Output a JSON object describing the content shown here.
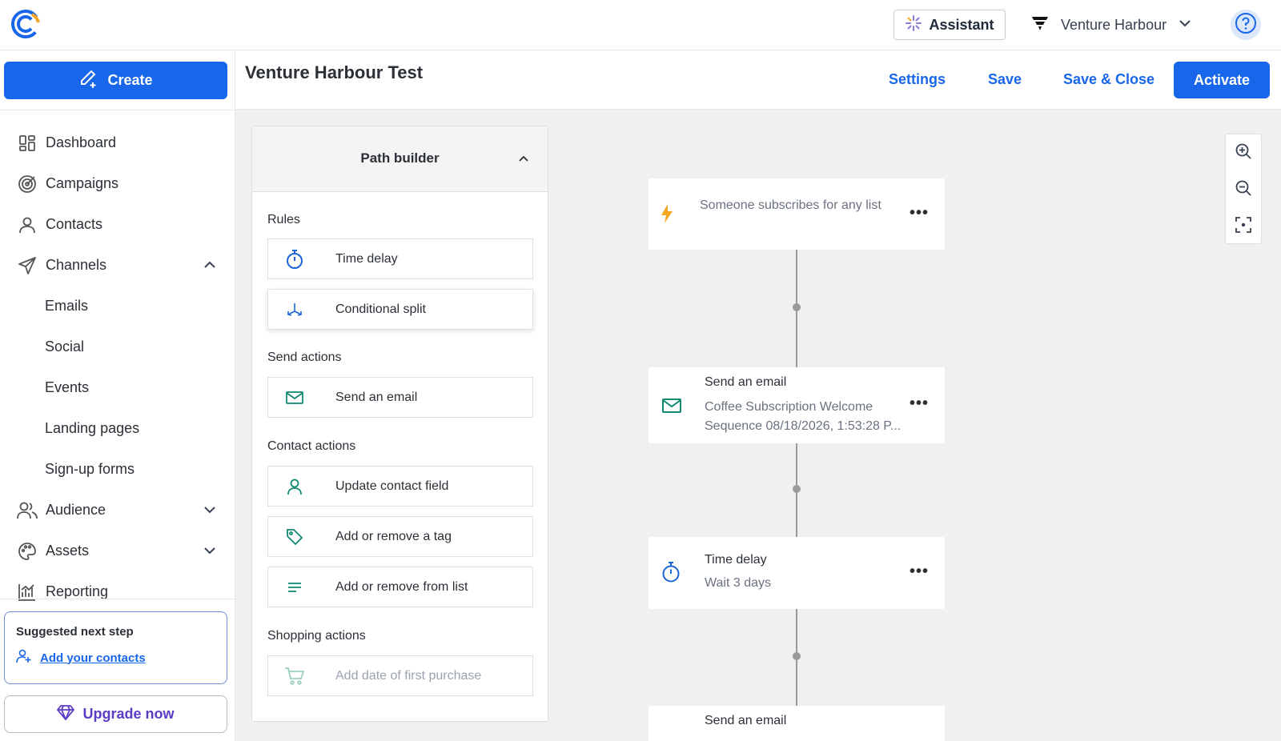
{
  "topbar": {
    "assistant_label": "Assistant",
    "account_name": "Venture Harbour"
  },
  "sidebar": {
    "create_label": "Create",
    "items": [
      {
        "label": "Dashboard"
      },
      {
        "label": "Campaigns"
      },
      {
        "label": "Contacts"
      },
      {
        "label": "Channels"
      },
      {
        "label": "Audience"
      },
      {
        "label": "Assets"
      },
      {
        "label": "Reporting"
      }
    ],
    "channels_sub": [
      "Emails",
      "Social",
      "Events",
      "Landing pages",
      "Sign-up forms"
    ],
    "suggest_title": "Suggested next step",
    "suggest_link": "Add your contacts",
    "upgrade_label": "Upgrade now"
  },
  "header": {
    "title": "Venture Harbour Test",
    "settings_label": "Settings",
    "save_label": "Save",
    "save_close_label": "Save & Close",
    "activate_label": "Activate"
  },
  "path_builder": {
    "title": "Path builder",
    "sections": {
      "rules": "Rules",
      "send_actions": "Send actions",
      "contact_actions": "Contact actions",
      "shopping_actions": "Shopping actions"
    },
    "cards": {
      "time_delay": "Time delay",
      "conditional_split": "Conditional split",
      "send_email": "Send an email",
      "update_contact": "Update contact field",
      "tag": "Add or remove a tag",
      "list": "Add or remove from list",
      "first_purchase": "Add date of first purchase"
    }
  },
  "workflow": {
    "trigger_text": "Someone subscribes for any list",
    "email_title": "Send an email",
    "email_desc": "Coffee Subscription Welcome Sequence 08/18/2026, 1:53:28 P...",
    "delay_title": "Time delay",
    "delay_desc": "Wait 3 days",
    "email2_title": "Send an email",
    "more_label": "•••"
  },
  "colors": {
    "primary": "#1866ea",
    "upgrade": "#5b3cc4",
    "trigger_bolt": "#f5a623",
    "email_icon": "#0f8a73",
    "delay_icon": "#1a66d6"
  }
}
